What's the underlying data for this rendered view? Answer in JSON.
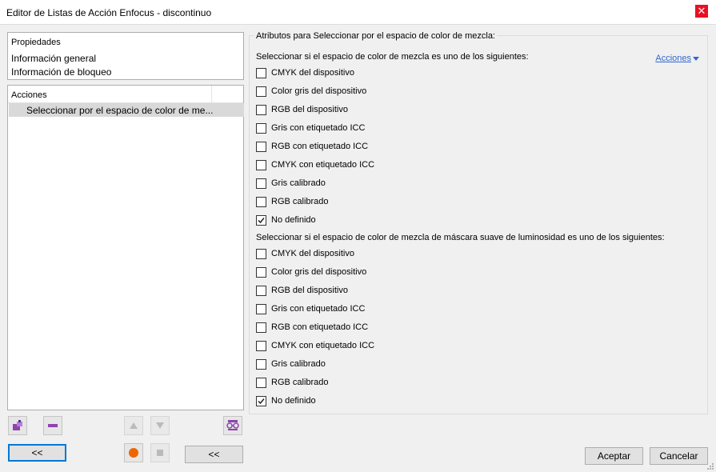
{
  "window": {
    "title": "Editor de Listas de Acción Enfocus - discontinuo",
    "close_glyph": "✕"
  },
  "properties": {
    "header": "Propiedades",
    "items": [
      {
        "label": "Información general"
      },
      {
        "label": "Información de bloqueo"
      }
    ]
  },
  "actions": {
    "header": "Acciones",
    "selected_item": "Seleccionar por el espacio de color de me..."
  },
  "toolbar": {
    "back_label": "<<",
    "back2_label": "<<"
  },
  "attributes": {
    "legend": "Atributos para Seleccionar por el espacio de color de mezcla:",
    "menu_link": "Acciones",
    "section1": {
      "label": "Seleccionar si el espacio de color de mezcla es uno de los siguientes:",
      "options": [
        {
          "label": "CMYK del dispositivo",
          "checked": false
        },
        {
          "label": "Color gris del dispositivo",
          "checked": false
        },
        {
          "label": "RGB del dispositivo",
          "checked": false
        },
        {
          "label": "Gris con etiquetado ICC",
          "checked": false
        },
        {
          "label": "RGB con etiquetado ICC",
          "checked": false
        },
        {
          "label": "CMYK con etiquetado ICC",
          "checked": false
        },
        {
          "label": "Gris calibrado",
          "checked": false
        },
        {
          "label": "RGB calibrado",
          "checked": false
        },
        {
          "label": "No definido",
          "checked": true
        }
      ]
    },
    "section2": {
      "label": "Seleccionar si el espacio de color de mezcla de máscara suave de luminosidad es uno de los siguientes:",
      "options": [
        {
          "label": "CMYK del dispositivo",
          "checked": false
        },
        {
          "label": "Color gris del dispositivo",
          "checked": false
        },
        {
          "label": "RGB del dispositivo",
          "checked": false
        },
        {
          "label": "Gris con etiquetado ICC",
          "checked": false
        },
        {
          "label": "RGB con etiquetado ICC",
          "checked": false
        },
        {
          "label": "CMYK con etiquetado ICC",
          "checked": false
        },
        {
          "label": "Gris calibrado",
          "checked": false
        },
        {
          "label": "RGB calibrado",
          "checked": false
        },
        {
          "label": "No definido",
          "checked": true
        }
      ]
    }
  },
  "footer": {
    "ok_label": "Aceptar",
    "cancel_label": "Cancelar"
  }
}
